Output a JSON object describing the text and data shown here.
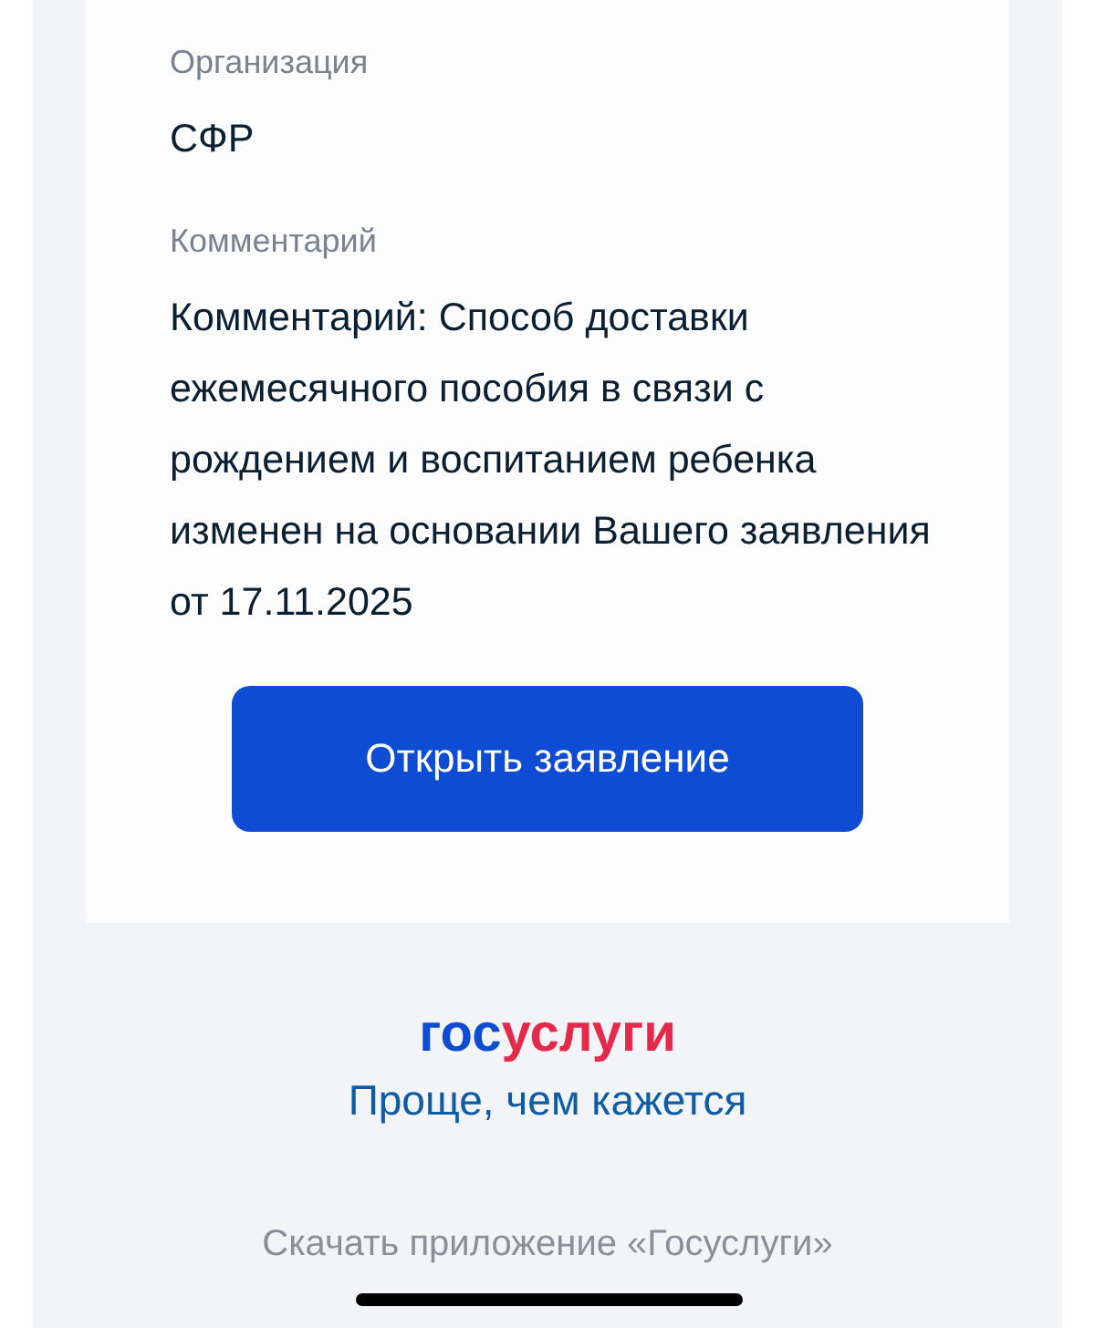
{
  "fields": [
    {
      "label": "Организация",
      "value": "СФР"
    },
    {
      "label": "Комментарий",
      "value": "Комментарий: Способ доставки ежемесячного пособия в связи с рождением и воспитанием ребенка изменен на основании Вашего заявления от 17.11.2025"
    }
  ],
  "button": "Открыть заявление",
  "logo": [
    {
      "text": "гос",
      "color": "#0d4cd3"
    },
    {
      "text": "услуги",
      "color": "#e5294b"
    }
  ],
  "tagline": "Проще, чем кажется",
  "download_link": "Скачать приложение «Госуслуги»"
}
